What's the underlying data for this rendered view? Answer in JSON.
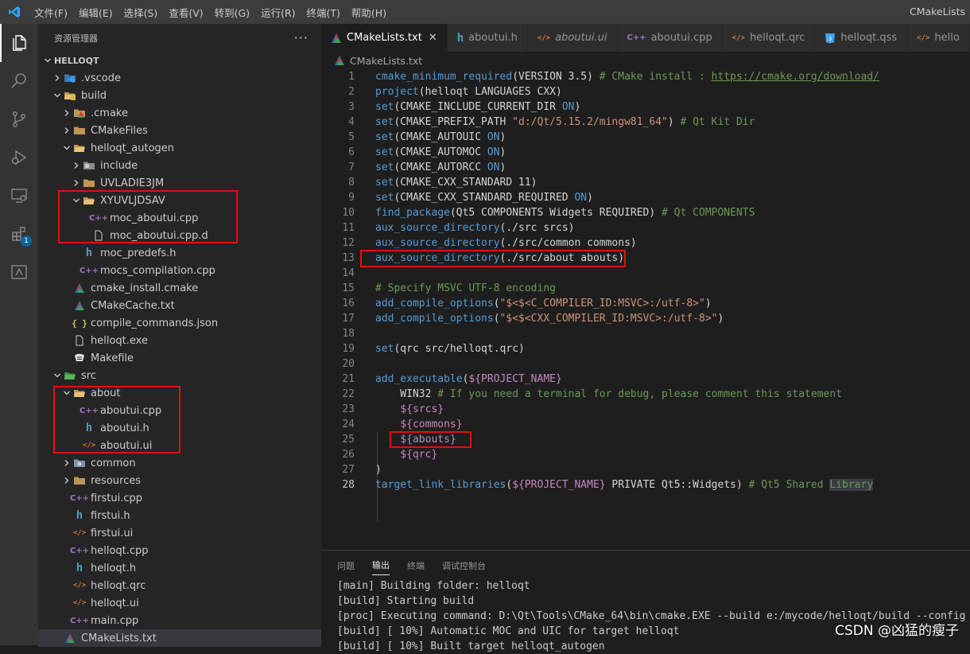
{
  "window": {
    "title": "CMakeLists"
  },
  "menu": [
    "文件(F)",
    "编辑(E)",
    "选择(S)",
    "查看(V)",
    "转到(G)",
    "运行(R)",
    "终端(T)",
    "帮助(H)"
  ],
  "activity_bar": {
    "extensions_badge": "1"
  },
  "explorer": {
    "title": "资源管理器",
    "more": "···",
    "root": "HELLOQT",
    "items": [
      {
        "label": ".vscode",
        "depth": 1,
        "twisty": "closed",
        "icon": "vscode-folder-icon"
      },
      {
        "label": "build",
        "depth": 1,
        "twisty": "open",
        "icon": "build-folder-icon"
      },
      {
        "label": ".cmake",
        "depth": 2,
        "twisty": "closed",
        "icon": "cmake-folder-icon"
      },
      {
        "label": "CMakeFiles",
        "depth": 2,
        "twisty": "closed",
        "icon": "folder-icon"
      },
      {
        "label": "helloqt_autogen",
        "depth": 2,
        "twisty": "open",
        "icon": "folder-open-icon"
      },
      {
        "label": "include",
        "depth": 3,
        "twisty": "closed",
        "icon": "include-folder-icon"
      },
      {
        "label": "UVLADIE3JM",
        "depth": 3,
        "twisty": "closed",
        "icon": "folder-icon"
      },
      {
        "label": "XYUVLJDSAV",
        "depth": 3,
        "twisty": "open",
        "icon": "folder-open-icon"
      },
      {
        "label": "moc_aboutui.cpp",
        "depth": 4,
        "twisty": "none",
        "icon": "cpp-file-icon"
      },
      {
        "label": "moc_aboutui.cpp.d",
        "depth": 4,
        "twisty": "none",
        "icon": "file-icon"
      },
      {
        "label": "moc_predefs.h",
        "depth": 3,
        "twisty": "none",
        "icon": "header-file-icon"
      },
      {
        "label": "mocs_compilation.cpp",
        "depth": 3,
        "twisty": "none",
        "icon": "cpp-file-icon"
      },
      {
        "label": "cmake_install.cmake",
        "depth": 2,
        "twisty": "none",
        "icon": "cmake-file-icon"
      },
      {
        "label": "CMakeCache.txt",
        "depth": 2,
        "twisty": "none",
        "icon": "cmake-file-icon"
      },
      {
        "label": "compile_commands.json",
        "depth": 2,
        "twisty": "none",
        "icon": "json-file-icon"
      },
      {
        "label": "helloqt.exe",
        "depth": 2,
        "twisty": "none",
        "icon": "file-icon"
      },
      {
        "label": "Makefile",
        "depth": 2,
        "twisty": "none",
        "icon": "makefile-icon"
      },
      {
        "label": "src",
        "depth": 1,
        "twisty": "open",
        "icon": "src-folder-icon"
      },
      {
        "label": "about",
        "depth": 2,
        "twisty": "open",
        "icon": "folder-open-icon"
      },
      {
        "label": "aboutui.cpp",
        "depth": 3,
        "twisty": "none",
        "icon": "cpp-file-icon"
      },
      {
        "label": "aboutui.h",
        "depth": 3,
        "twisty": "none",
        "icon": "header-file-icon"
      },
      {
        "label": "aboutui.ui",
        "depth": 3,
        "twisty": "none",
        "icon": "xml-file-icon"
      },
      {
        "label": "common",
        "depth": 2,
        "twisty": "closed",
        "icon": "common-folder-icon"
      },
      {
        "label": "resources",
        "depth": 2,
        "twisty": "closed",
        "icon": "folder-icon"
      },
      {
        "label": "firstui.cpp",
        "depth": 2,
        "twisty": "none",
        "icon": "cpp-file-icon"
      },
      {
        "label": "firstui.h",
        "depth": 2,
        "twisty": "none",
        "icon": "header-file-icon"
      },
      {
        "label": "firstui.ui",
        "depth": 2,
        "twisty": "none",
        "icon": "xml-file-icon"
      },
      {
        "label": "helloqt.cpp",
        "depth": 2,
        "twisty": "none",
        "icon": "cpp-file-icon"
      },
      {
        "label": "helloqt.h",
        "depth": 2,
        "twisty": "none",
        "icon": "header-file-icon"
      },
      {
        "label": "helloqt.qrc",
        "depth": 2,
        "twisty": "none",
        "icon": "xml-file-icon"
      },
      {
        "label": "helloqt.ui",
        "depth": 2,
        "twisty": "none",
        "icon": "xml-file-icon"
      },
      {
        "label": "main.cpp",
        "depth": 2,
        "twisty": "none",
        "icon": "cpp-file-icon"
      },
      {
        "label": "CMakeLists.txt",
        "depth": 1,
        "twisty": "none",
        "icon": "cmake-file-icon",
        "selected": true
      }
    ]
  },
  "tabs": [
    {
      "label": "CMakeLists.txt",
      "icon": "cmake-file-icon",
      "active": true,
      "close": "✕"
    },
    {
      "label": "aboutui.h",
      "icon": "header-file-icon"
    },
    {
      "label": "aboutui.ui",
      "icon": "xml-file-icon",
      "italic": true
    },
    {
      "label": "aboutui.cpp",
      "icon": "cpp-file-icon"
    },
    {
      "label": "helloqt.qrc",
      "icon": "xml-file-icon"
    },
    {
      "label": "helloqt.qss",
      "icon": "css-file-icon"
    },
    {
      "label": "hello",
      "icon": "xml-file-icon"
    }
  ],
  "breadcrumb": "CMakeLists.txt",
  "code": [
    {
      "n": "1",
      "segs": [
        [
          "fn",
          "cmake_minimum_required"
        ],
        [
          "p",
          "(VERSION 3.5) "
        ],
        [
          "cm",
          "# CMake install : "
        ],
        [
          "link",
          "https://cmake.org/download/"
        ]
      ]
    },
    {
      "n": "2",
      "segs": [
        [
          "fn",
          "project"
        ],
        [
          "p",
          "(helloqt LANGUAGES CXX)"
        ]
      ]
    },
    {
      "n": "3",
      "segs": [
        [
          "fn",
          "set"
        ],
        [
          "p",
          "(CMAKE_INCLUDE_CURRENT_DIR "
        ],
        [
          "kw",
          "ON"
        ],
        [
          "p",
          ")"
        ]
      ]
    },
    {
      "n": "4",
      "segs": [
        [
          "fn",
          "set"
        ],
        [
          "p",
          "(CMAKE_PREFIX_PATH "
        ],
        [
          "str",
          "\"d:/Qt/5.15.2/mingw81_64\""
        ],
        [
          "p",
          ") "
        ],
        [
          "cm",
          "# Qt Kit Dir"
        ]
      ]
    },
    {
      "n": "5",
      "segs": [
        [
          "fn",
          "set"
        ],
        [
          "p",
          "(CMAKE_AUTOUIC "
        ],
        [
          "kw",
          "ON"
        ],
        [
          "p",
          ")"
        ]
      ]
    },
    {
      "n": "6",
      "segs": [
        [
          "fn",
          "set"
        ],
        [
          "p",
          "(CMAKE_AUTOMOC "
        ],
        [
          "kw",
          "ON"
        ],
        [
          "p",
          ")"
        ]
      ]
    },
    {
      "n": "7",
      "segs": [
        [
          "fn",
          "set"
        ],
        [
          "p",
          "(CMAKE_AUTORCC "
        ],
        [
          "kw",
          "ON"
        ],
        [
          "p",
          ")"
        ]
      ]
    },
    {
      "n": "8",
      "segs": [
        [
          "fn",
          "set"
        ],
        [
          "p",
          "(CMAKE_CXX_STANDARD 11)"
        ]
      ]
    },
    {
      "n": "9",
      "segs": [
        [
          "fn",
          "set"
        ],
        [
          "p",
          "(CMAKE_CXX_STANDARD_REQUIRED "
        ],
        [
          "kw",
          "ON"
        ],
        [
          "p",
          ")"
        ]
      ]
    },
    {
      "n": "10",
      "segs": [
        [
          "fn",
          "find_package"
        ],
        [
          "p",
          "(Qt5 COMPONENTS Widgets REQUIRED) "
        ],
        [
          "cm",
          "# Qt COMPONENTS"
        ]
      ]
    },
    {
      "n": "11",
      "segs": [
        [
          "fn",
          "aux_source_directory"
        ],
        [
          "p",
          "(./src srcs)"
        ]
      ]
    },
    {
      "n": "12",
      "segs": [
        [
          "fn",
          "aux_source_directory"
        ],
        [
          "p",
          "(./src/common commons)"
        ]
      ]
    },
    {
      "n": "13",
      "segs": [
        [
          "fn",
          "aux_source_directory"
        ],
        [
          "p",
          "(./src/about abouts)"
        ]
      ]
    },
    {
      "n": "14",
      "segs": []
    },
    {
      "n": "15",
      "segs": [
        [
          "cm",
          "# Specify MSVC UTF-8 encoding"
        ]
      ]
    },
    {
      "n": "16",
      "segs": [
        [
          "fn",
          "add_compile_options"
        ],
        [
          "p",
          "("
        ],
        [
          "str",
          "\"$<$<C_COMPILER_ID:MSVC>:/utf-8>\""
        ],
        [
          "p",
          ")"
        ]
      ]
    },
    {
      "n": "17",
      "segs": [
        [
          "fn",
          "add_compile_options"
        ],
        [
          "p",
          "("
        ],
        [
          "str",
          "\"$<$<CXX_COMPILER_ID:MSVC>:/utf-8>\""
        ],
        [
          "p",
          ")"
        ]
      ]
    },
    {
      "n": "18",
      "segs": []
    },
    {
      "n": "19",
      "segs": [
        [
          "fn",
          "set"
        ],
        [
          "p",
          "(qrc src/helloqt.qrc)"
        ]
      ]
    },
    {
      "n": "20",
      "segs": []
    },
    {
      "n": "21",
      "segs": [
        [
          "fn",
          "add_executable"
        ],
        [
          "p",
          "("
        ],
        [
          "var",
          "${PROJECT_NAME}"
        ]
      ]
    },
    {
      "n": "22",
      "segs": [
        [
          "p",
          "    WIN32 "
        ],
        [
          "cm",
          "# If you need a terminal for debug, please comment this statement"
        ]
      ]
    },
    {
      "n": "23",
      "segs": [
        [
          "p",
          "    "
        ],
        [
          "var",
          "${srcs}"
        ]
      ]
    },
    {
      "n": "24",
      "segs": [
        [
          "p",
          "    "
        ],
        [
          "var",
          "${commons}"
        ]
      ]
    },
    {
      "n": "25",
      "segs": [
        [
          "p",
          "    "
        ],
        [
          "var",
          "${abouts}"
        ]
      ]
    },
    {
      "n": "26",
      "segs": [
        [
          "p",
          "    "
        ],
        [
          "var",
          "${qrc}"
        ]
      ]
    },
    {
      "n": "27",
      "segs": [
        [
          "p",
          ")"
        ]
      ]
    },
    {
      "n": "28",
      "segs": [
        [
          "fn",
          "target_link_libraries"
        ],
        [
          "p",
          "("
        ],
        [
          "var",
          "${PROJECT_NAME}"
        ],
        [
          "p",
          " PRIVATE Qt5::Widgets) "
        ],
        [
          "cm",
          "# Qt5 Shared "
        ],
        [
          "hl",
          "Library"
        ]
      ]
    }
  ],
  "current_line": "28",
  "panel": {
    "tabs": [
      {
        "label": "问题"
      },
      {
        "label": "输出",
        "active": true
      },
      {
        "label": "终端"
      },
      {
        "label": "调试控制台"
      }
    ],
    "output": [
      "[main] Building folder: helloqt",
      "[build] Starting build",
      "[proc] Executing command: D:\\Qt\\Tools\\CMake_64\\bin\\cmake.EXE --build e:/mycode/helloqt/build --config De",
      "[build] [ 10%] Automatic MOC and UIC for target helloqt",
      "[build] [ 10%] Built target helloqt_autogen"
    ]
  },
  "watermark": "CSDN @凶猛的瘦子",
  "colors": {
    "highlight_box": "#e01010",
    "accent": "#0e639c"
  }
}
